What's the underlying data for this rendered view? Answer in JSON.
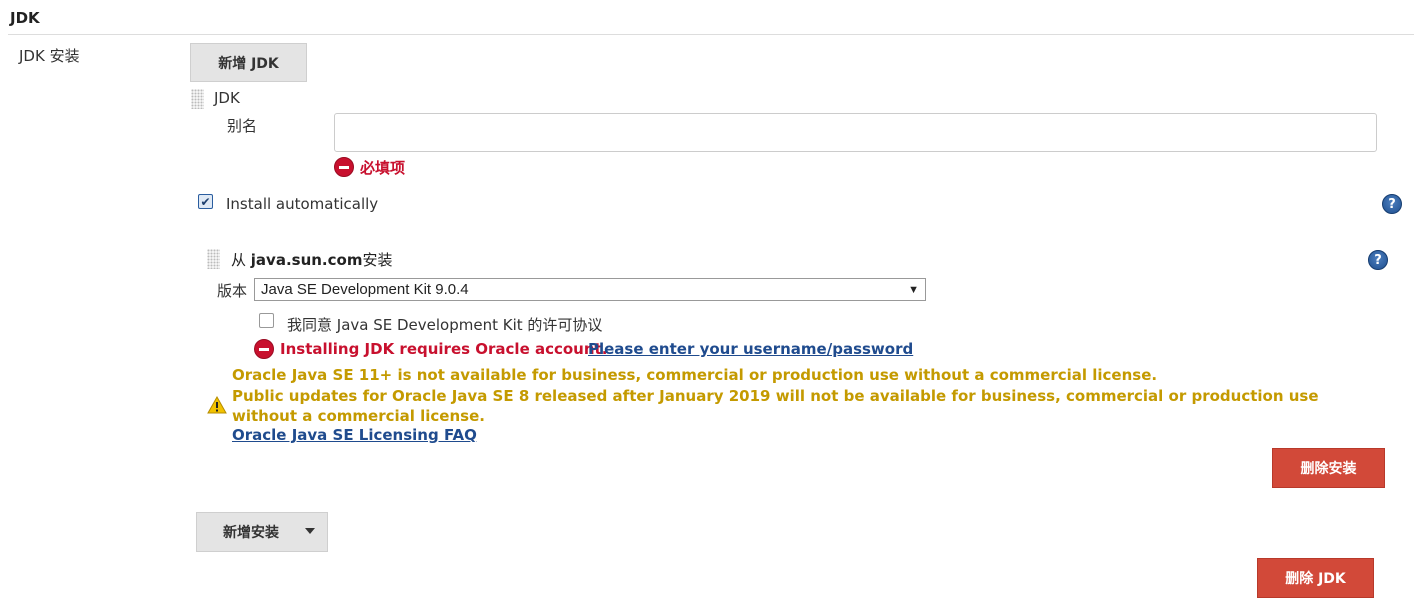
{
  "section": {
    "title": "JDK"
  },
  "jdk_install": {
    "label": "JDK 安装",
    "add_jdk_button": "新增 JDK",
    "jdk_entry_title": "JDK",
    "alias_label": "别名",
    "alias_value": "",
    "alias_required_error": "必填项",
    "install_automatically": {
      "label": "Install automatically",
      "checked": true
    },
    "installer": {
      "title_prefix": "从 ",
      "title_bold": "java.sun.com",
      "title_suffix": "安装",
      "version_label": "版本",
      "version_selected": "Java SE Development Kit 9.0.4",
      "agree_label": "我同意 Java SE Development Kit 的许可协议",
      "agree_checked": false,
      "oracle_error": "Installing JDK requires Oracle account.",
      "oracle_link": "Please enter your username/password",
      "warning_line1": "Oracle Java SE 11+ is not available for business, commercial or production use without a commercial license.",
      "warning_line2": "Public updates for Oracle Java SE 8 released after January 2019 will not be available for business, commercial or production use without a commercial license.",
      "faq_link": "Oracle Java SE Licensing FAQ",
      "delete_install_button": "删除安装"
    },
    "add_install_button": "新增安装",
    "delete_jdk_button": "删除 JDK"
  },
  "icons": {
    "help": "help-icon",
    "error": "error-icon",
    "warning": "warning-icon",
    "drag": "drag-handle-icon"
  },
  "colors": {
    "error": "#c8102e",
    "warning": "#c49a00",
    "link": "#1f4b8e",
    "danger_button": "#d24939"
  }
}
